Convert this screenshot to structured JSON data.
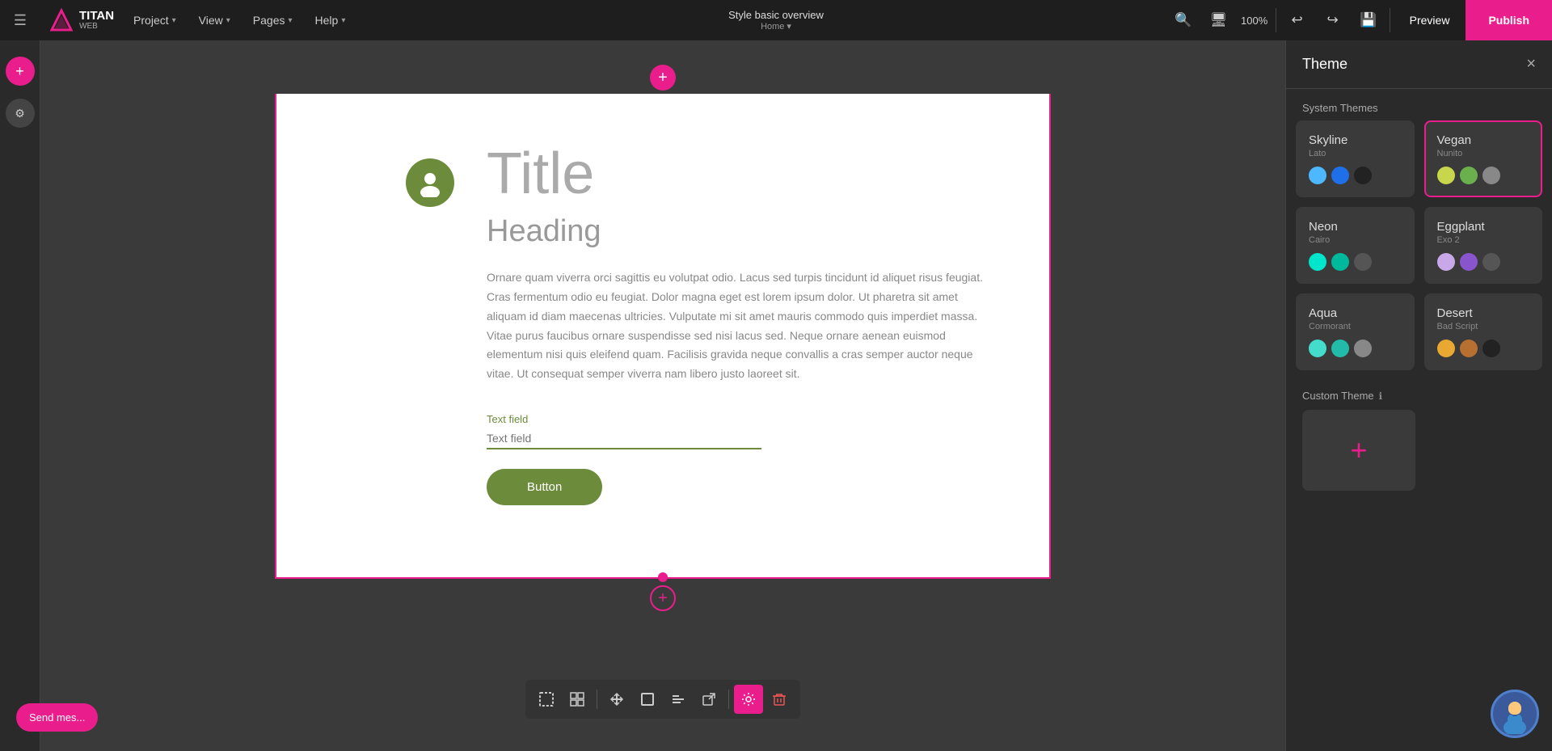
{
  "topNav": {
    "hamburger": "☰",
    "logoText": "TITAN",
    "logoSub": "WEB",
    "menuItems": [
      {
        "label": "Project",
        "hasChevron": true
      },
      {
        "label": "View",
        "hasChevron": true
      },
      {
        "label": "Pages",
        "hasChevron": true
      },
      {
        "label": "Help",
        "hasChevron": true
      }
    ],
    "centerTitle": "Style basic overview",
    "centerSub": "Home",
    "previewLabel": "Preview",
    "publishLabel": "Publish"
  },
  "canvas": {
    "addTopIcon": "+",
    "addBottomIcon": "+",
    "title": "Title",
    "heading": "Heading",
    "bodyText": "Ornare quam viverra orci sagittis eu volutpat odio. Lacus sed turpis tincidunt id aliquet risus feugiat. Cras fermentum odio eu feugiat. Dolor magna eget est lorem ipsum dolor. Ut pharetra sit amet aliquam id diam maecenas ultricies. Vulputate mi sit amet mauris commodo quis imperdiet massa. Vitae purus faucibus ornare suspendisse sed nisi lacus sed. Neque ornare aenean euismod elementum nisi quis eleifend quam. Facilisis gravida neque convallis a cras semper auctor neque vitae. Ut consequat semper viverra nam libero justo laoreet sit.",
    "textFieldLabel": "Text field",
    "textFieldPlaceholder": "Text field",
    "buttonLabel": "Button"
  },
  "toolbar": {
    "buttons": [
      {
        "icon": "⊡",
        "name": "dashed-border",
        "active": false
      },
      {
        "icon": "⊞",
        "name": "grid",
        "active": false
      },
      {
        "icon": "↔",
        "name": "move",
        "active": false
      },
      {
        "icon": "□",
        "name": "container",
        "active": false
      },
      {
        "icon": "⊢",
        "name": "align-left",
        "active": false
      },
      {
        "icon": "⬡",
        "name": "external-link",
        "active": false
      },
      {
        "icon": "⚙",
        "name": "settings",
        "active": true
      },
      {
        "icon": "🗑",
        "name": "delete",
        "danger": true
      }
    ]
  },
  "themePanel": {
    "title": "Theme",
    "closeIcon": "×",
    "systemThemesLabel": "System Themes",
    "themes": [
      {
        "name": "Skyline",
        "font": "Lato",
        "colors": [
          "#4db8ff",
          "#1e6fe8",
          "#222222"
        ],
        "selected": false
      },
      {
        "name": "Vegan",
        "font": "Nunito",
        "colors": [
          "#c8d64c",
          "#6ab04c",
          "#888888"
        ],
        "selected": true
      },
      {
        "name": "Neon",
        "font": "Cairo",
        "colors": [
          "#00e5cc",
          "#00b89c",
          "#555555"
        ],
        "selected": false
      },
      {
        "name": "Eggplant",
        "font": "Exo 2",
        "colors": [
          "#c8a8e8",
          "#8855cc",
          "#555555"
        ],
        "selected": false
      },
      {
        "name": "Aqua",
        "font": "Cormorant",
        "colors": [
          "#44ddcc",
          "#22bbaa",
          "#888888"
        ],
        "selected": false
      },
      {
        "name": "Desert",
        "font": "Bad Script",
        "colors": [
          "#e8a832",
          "#b87030",
          "#222222"
        ],
        "selected": false
      }
    ],
    "customThemeLabel": "Custom Theme",
    "customThemeAddIcon": "+"
  },
  "chat": {
    "label": "Send mes..."
  }
}
